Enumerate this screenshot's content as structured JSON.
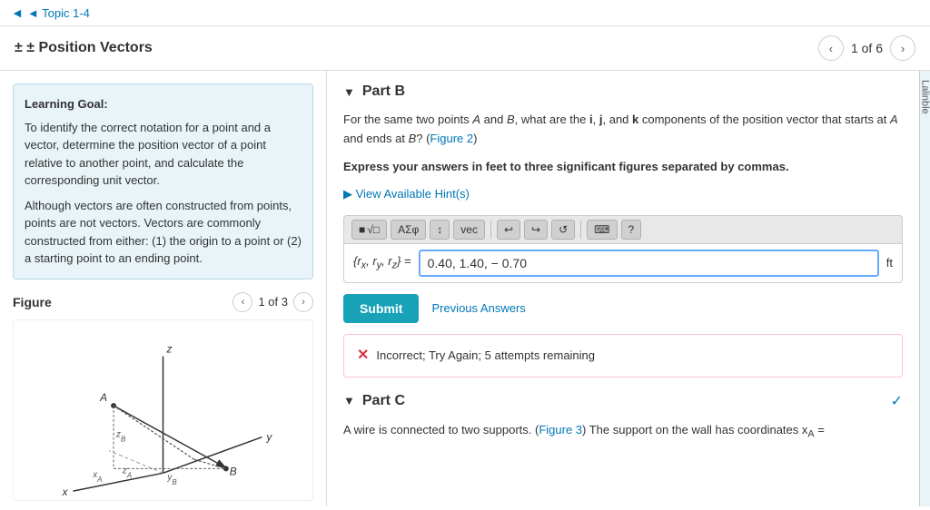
{
  "topNav": {
    "backLabel": "◄ Topic 1-4"
  },
  "header": {
    "title": "± Position Vectors",
    "pagination": {
      "current": "1",
      "total": "6",
      "display": "1 of 6"
    },
    "prevArrow": "‹",
    "nextArrow": "›"
  },
  "leftPanel": {
    "learningGoal": {
      "title": "Learning Goal:",
      "paragraph1": "To identify the correct notation for a point and a vector, determine the position vector of a point relative to another point, and calculate the corresponding unit vector.",
      "paragraph2": "Although vectors are often constructed from points, points are not vectors. Vectors are commonly constructed from either: (1) the origin to a point or (2) a starting point to an ending point."
    },
    "figure": {
      "label": "Figure",
      "pagination": {
        "display": "1 of 3",
        "current": "1",
        "total": "3"
      },
      "prevArrow": "‹",
      "nextArrow": "›"
    }
  },
  "rightPanel": {
    "partB": {
      "label": "Part B",
      "arrow": "▼",
      "questionText": "For the same two points A and B, what are the i, j, and k components of the position vector that starts at A and ends at B? (Figure 2)",
      "linkText": "Figure 2",
      "boldText": "Express your answers in feet to three significant figures separated by commas.",
      "hintText": "▶ View Available Hint(s)",
      "toolbar": {
        "btn1": "■√□",
        "btn2": "ΑΣφ",
        "btn3": "↕",
        "btn4": "vec",
        "btn5": "↩",
        "btn6": "↪",
        "btn7": "↺",
        "btn8": "⌨",
        "btn9": "?"
      },
      "answerLabel": "{rx, ry, rz} =",
      "answerValue": "0.40, 1.40, − 0.70",
      "answerUnit": "ft",
      "submitLabel": "Submit",
      "prevAnswersLabel": "Previous Answers",
      "errorText": "Incorrect; Try Again; 5 attempts remaining"
    },
    "partC": {
      "label": "Part C",
      "arrow": "▼",
      "checkmark": "✓",
      "introText": "A wire is connected to two supports. (Figure 3) The support on the wall has coordinates xA ="
    }
  }
}
